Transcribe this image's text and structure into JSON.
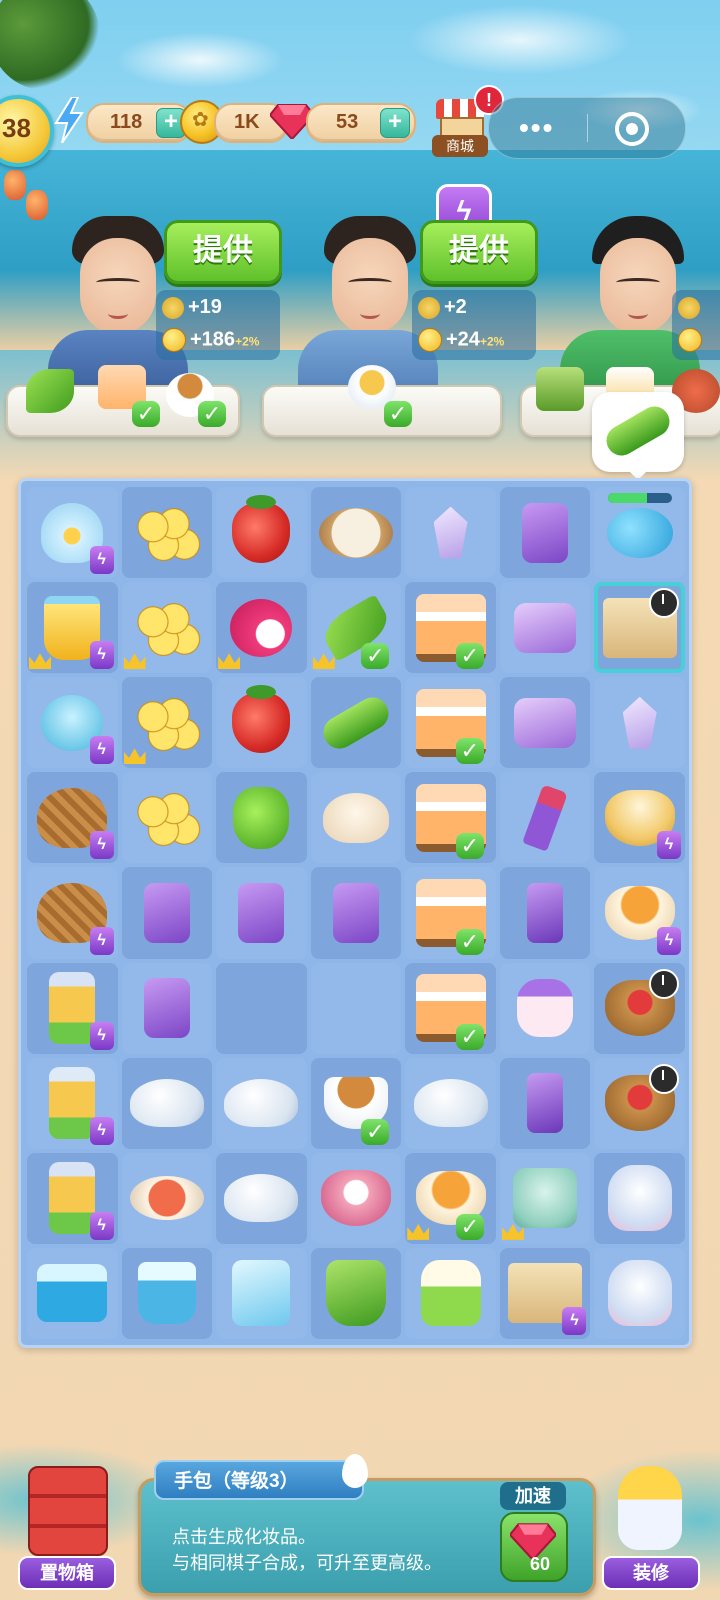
{
  "colors": {
    "board_bg": "#8fb6e8",
    "serve_button": "#5fc12a",
    "plus_button": "#36b79b",
    "generator_badge": "#8b3fd1",
    "alert": "#e0263a"
  },
  "top_bar": {
    "level": "38",
    "energy": "118",
    "coins": "1K",
    "gems": "53",
    "plus_symbol": "+",
    "shop_label": "商城",
    "shop_alert": "!",
    "more_menu": "•••"
  },
  "customers": [
    {
      "serve_label": "提供",
      "reward_xp": "+19",
      "reward_coins": "+186",
      "reward_bonus": "+2%",
      "order_items": [
        "okra",
        "flower-cake",
        "tea-cup"
      ]
    },
    {
      "serve_label": "提供",
      "reward_xp": "+2",
      "reward_coins": "+24",
      "reward_bonus": "+2%",
      "order_items": [
        "soup-bowl"
      ]
    },
    {
      "order_items": [
        "flower-cake",
        "cake",
        "meat-dish"
      ]
    }
  ],
  "hint_item": "cucumber",
  "board": {
    "rows": [
      [
        "goldfish-bag",
        "gold-coins",
        "strawberry",
        "frying-pan",
        "fishing-rod",
        "perfume",
        "whale-generator"
      ],
      [
        "water-bucket",
        "gold-coins",
        "dragon-fruit",
        "okra",
        "flower-cake",
        "powder-compact",
        "makeup-bag"
      ],
      [
        "fish-bowl",
        "gold-coins",
        "strawberry",
        "cucumber",
        "flower-cake",
        "blush-compact",
        "crystal"
      ],
      [
        "corn-basket",
        "gold-coins",
        "green-pepper",
        "bun",
        "layer-cake",
        "lipstick",
        "clay-pot"
      ],
      [
        "vegetable-basket",
        "lotion-tube",
        "lotion-tube",
        "lotion-tube",
        "layer-cake",
        "perfume-bottle",
        "soup-pot"
      ],
      [
        "juice-blender",
        "lotion-tube",
        "",
        "",
        "mango-cake",
        "cream-jar",
        "cherry-basket"
      ],
      [
        "tea-blender",
        "teapot",
        "teapot",
        "tea-cup",
        "teapot",
        "serum-bottle",
        "cherry-basket"
      ],
      [
        "juice-maker",
        "salmon-plate",
        "teapot",
        "meat-dish",
        "soup-bowl",
        "tea-set",
        "flower-teapot"
      ],
      [
        "ice-cooler",
        "ice-bucket",
        "ice-fridge",
        "green-jug",
        "juicer",
        "shopping-bag",
        "flower-teapot"
      ]
    ]
  },
  "selected_item": {
    "title": "手包（等级3）",
    "description_line1": "点击生成化妆品。",
    "description_line2": "与相同棋子合成，可升至更高级。",
    "speed_up_label": "加速",
    "speed_up_cost": "60"
  },
  "bottom": {
    "storage_label": "置物箱",
    "decorate_label": "装修"
  },
  "energy_bar_fill": 0.6
}
